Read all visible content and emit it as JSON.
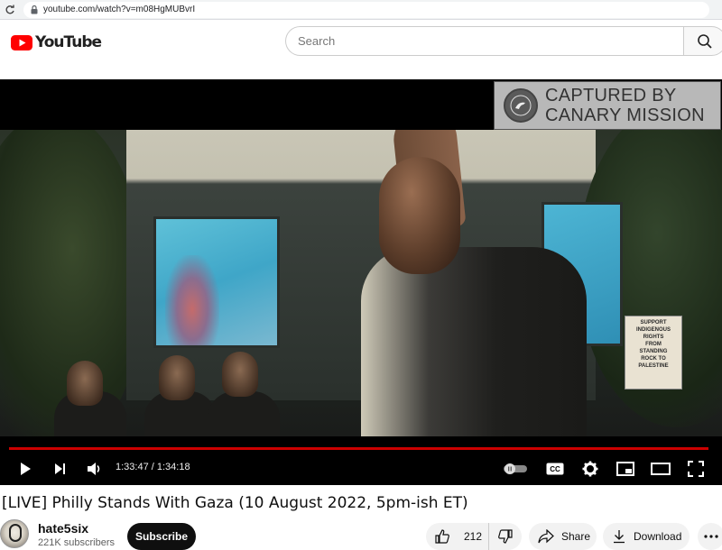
{
  "browser": {
    "url": "youtube.com/watch?v=m08HgMUBvrI"
  },
  "header": {
    "logo_text": "YouTube",
    "search_placeholder": "Search"
  },
  "player": {
    "watermark_line1": "CAPTURED BY",
    "watermark_line2": "CANARY MISSION",
    "current_time": "1:33:47",
    "duration": "1:34:18",
    "time_display": "1:33:47 / 1:34:18",
    "progress_fraction": 0.994,
    "sign_text": [
      "SUPPORT",
      "INDIGENOUS",
      "RIGHTS",
      "FROM",
      "STANDING",
      "ROCK TO",
      "PALESTINE"
    ],
    "accent_color": "#cc0000"
  },
  "video": {
    "title": "[LIVE] Philly Stands With Gaza (10 August 2022, 5pm-ish ET)"
  },
  "channel": {
    "name": "hate5six",
    "subscribers": "221K subscribers",
    "subscribe_label": "Subscribe"
  },
  "actions": {
    "like_count": "212",
    "share_label": "Share",
    "download_label": "Download"
  }
}
